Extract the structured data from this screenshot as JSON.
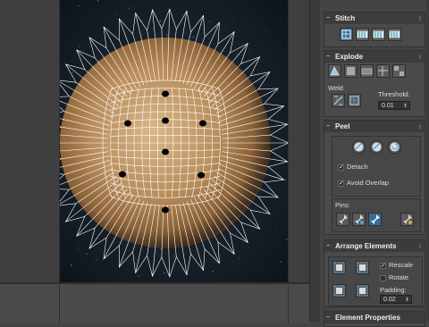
{
  "colors": {
    "accent": "#3a6c95",
    "panel": "#444444",
    "rollout_header": "#3c3c3c",
    "wire": "#ffffff"
  },
  "stitch": {
    "title": "Stitch",
    "icons": [
      "stitch-custom-icon",
      "stitch-source-icon",
      "stitch-average-icon",
      "stitch-target-icon"
    ]
  },
  "explode": {
    "title": "Explode",
    "icons": [
      "break-icon",
      "detach-icon",
      "flatten-by-polygon-angle-icon",
      "flatten-by-smoothing-group-icon",
      "flatten-by-material-id-icon"
    ],
    "weld_label": "Weld",
    "threshold_label": "Threshold:",
    "threshold_value": "0.01"
  },
  "peel": {
    "title": "Peel",
    "icons": [
      "quick-peel-icon",
      "peel-mode-icon",
      "reset-peel-icon"
    ],
    "detach_label": "Detach",
    "detach_checked": true,
    "avoid_overlap_label": "Avoid Overlap",
    "avoid_overlap_checked": true,
    "pins_label": "Pins:"
  },
  "arrange": {
    "title": "Arrange Elements",
    "rescale_label": "Rescale",
    "rescale_checked": true,
    "rotate_label": "Rotate",
    "rotate_checked": false,
    "padding_label": "Padding:",
    "padding_value": "0.02"
  },
  "element_properties": {
    "title": "Element Properties"
  }
}
